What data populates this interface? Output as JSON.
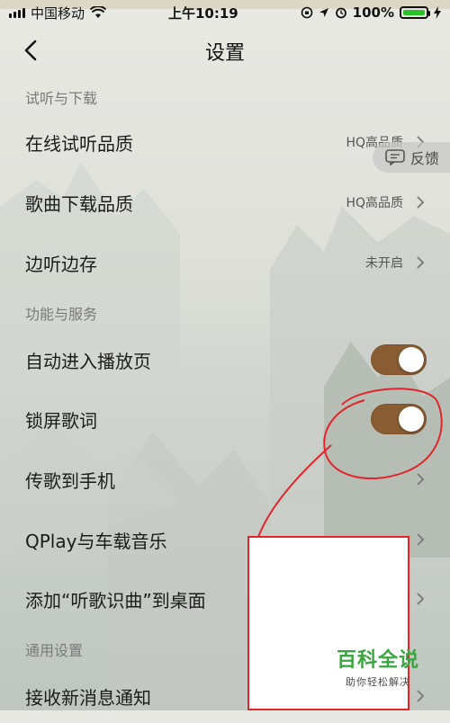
{
  "status_bar": {
    "carrier": "中国移动",
    "time": "上午10:19",
    "battery": "100%"
  },
  "nav": {
    "title": "设置"
  },
  "sections": [
    {
      "header": "试听与下载",
      "rows": [
        {
          "label": "在线试听品质",
          "value": "HQ高品质"
        },
        {
          "label": "歌曲下载品质",
          "value": "HQ高品质"
        },
        {
          "label": "边听边存",
          "value": "未开启"
        }
      ]
    },
    {
      "header": "功能与服务",
      "rows": [
        {
          "label": "自动进入播放页",
          "toggle": "on"
        },
        {
          "label": "锁屏歌词",
          "toggle": "on"
        },
        {
          "label": "传歌到手机"
        },
        {
          "label": "QPlay与车载音乐"
        },
        {
          "label": "添加“听歌识曲”到桌面"
        }
      ]
    },
    {
      "header": "通用设置",
      "rows": [
        {
          "label": "接收新消息通知"
        }
      ]
    }
  ],
  "feedback": {
    "label": "反馈"
  },
  "watermark": {
    "title": "百科全说",
    "subtitle": "助你轻松解决"
  },
  "colors": {
    "toggle_on": "#8a5c32",
    "annotation": "#e0262a",
    "watermark_green": "#3aa640"
  }
}
